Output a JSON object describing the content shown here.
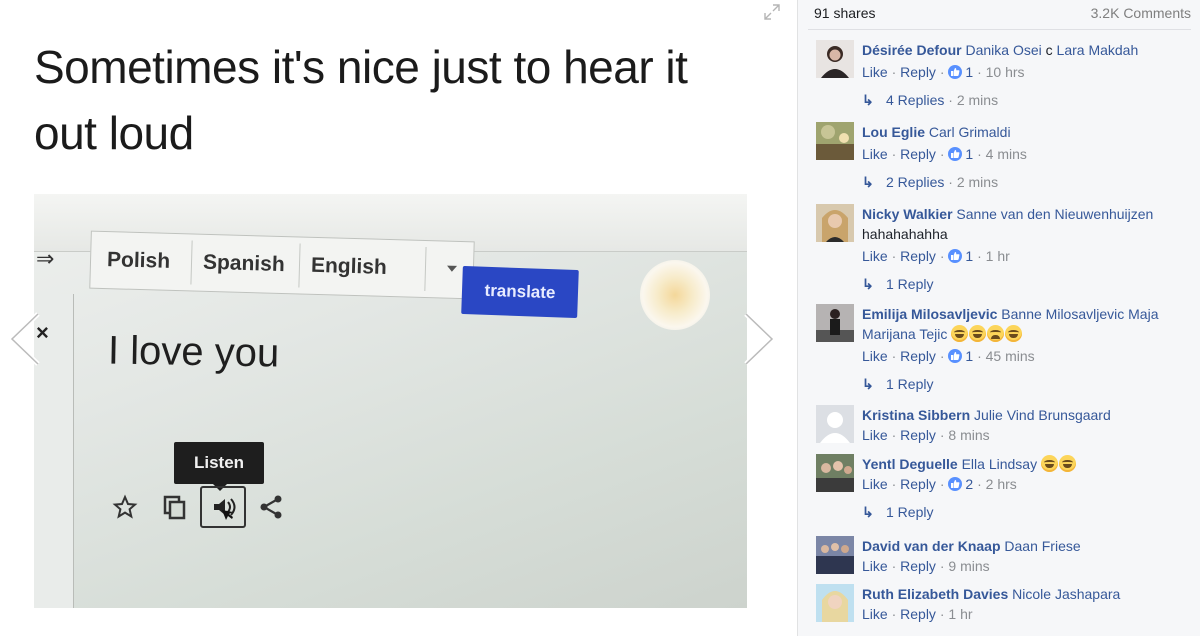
{
  "post": {
    "meme_text": "Sometimes it's nice just to hear it out loud",
    "photo": {
      "languages": [
        "Polish",
        "Spanish",
        "English"
      ],
      "translate_label": "translate",
      "close_glyph": "×",
      "arrow_glyph": "⇒",
      "phrase": "I love you",
      "tooltip": "Listen",
      "tools": [
        "star-icon",
        "copy-icon",
        "speaker-icon",
        "share-icon"
      ]
    }
  },
  "panel": {
    "shares": "91 shares",
    "comments_count": "3.2K Comments",
    "like_label": "Like",
    "reply_label": "Reply",
    "comments": [
      {
        "author": "Désirée Defour",
        "text_parts": [
          {
            "kind": "mention",
            "text": "Danika Osei"
          },
          {
            "kind": "plain",
            "text": " c "
          },
          {
            "kind": "mention",
            "text": "Lara Makdah"
          }
        ],
        "likes": "1",
        "time": "10 hrs",
        "replies": {
          "label": "4 Replies",
          "time": "2 mins"
        }
      },
      {
        "author": "Lou Eglie",
        "text_parts": [
          {
            "kind": "mention",
            "text": "Carl Grimaldi"
          }
        ],
        "likes": "1",
        "time": "4 mins",
        "replies": {
          "label": "2 Replies",
          "time": "2 mins"
        }
      },
      {
        "author": "Nicky Walkier",
        "text_parts": [
          {
            "kind": "mention",
            "text": "Sanne van den Nieuwenhuijzen"
          },
          {
            "kind": "plain",
            "text": " hahahahahha"
          }
        ],
        "likes": "1",
        "time": "1 hr",
        "replies": {
          "label": "1 Reply",
          "time": ""
        }
      },
      {
        "author": "Emilija Milosavljevic",
        "text_parts": [
          {
            "kind": "mention",
            "text": "Banne Milosavljevic Maja Marijana Tejic"
          }
        ],
        "emojis": [
          "laughing-emoji",
          "laughing-emoji",
          "sad-emoji",
          "laughing-emoji"
        ],
        "likes": "1",
        "time": "45 mins",
        "replies": {
          "label": "1 Reply",
          "time": ""
        }
      },
      {
        "author": "Kristina Sibbern",
        "text_parts": [
          {
            "kind": "mention",
            "text": "Julie Vind Brunsgaard"
          }
        ],
        "likes": "",
        "time": "8 mins",
        "replies": null
      },
      {
        "author": "Yentl Deguelle",
        "text_parts": [
          {
            "kind": "mention",
            "text": "Ella Lindsay"
          }
        ],
        "emojis": [
          "laughing-emoji",
          "laughing-emoji"
        ],
        "likes": "2",
        "time": "2 hrs",
        "replies": {
          "label": "1 Reply",
          "time": ""
        }
      },
      {
        "author": "David van der Knaap",
        "text_parts": [
          {
            "kind": "mention",
            "text": "Daan Friese"
          }
        ],
        "likes": "",
        "time": "9 mins",
        "replies": null
      },
      {
        "author": "Ruth Elizabeth Davies",
        "text_parts": [
          {
            "kind": "mention",
            "text": "Nicole Jashapara"
          }
        ],
        "likes": "",
        "time": "1 hr",
        "replies": null
      }
    ]
  },
  "colors": {
    "link": "#365899",
    "meta": "#8a8d91",
    "like_badge": "#5890ff",
    "translate_button": "#2a47c4"
  }
}
